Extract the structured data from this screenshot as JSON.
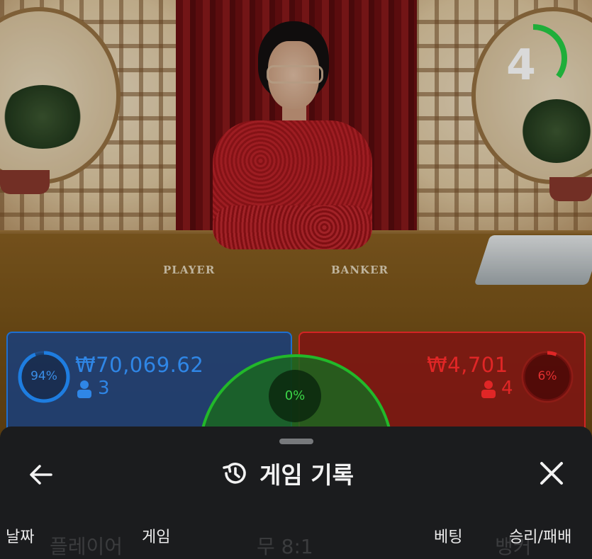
{
  "table": {
    "player_label": "PLAYER",
    "banker_label": "BANKER"
  },
  "timer": {
    "seconds": "4",
    "progress": 0.35,
    "color": "#1fae3a"
  },
  "bets": {
    "player": {
      "percent": "94%",
      "percent_value": 0.94,
      "amount": "₩70,069.62",
      "players": "3",
      "color": "#1e7de0"
    },
    "tie": {
      "percent": "0%",
      "color": "#3cd648"
    },
    "banker": {
      "percent": "6%",
      "percent_value": 0.06,
      "amount": "₩4,701",
      "players": "4",
      "color": "#e02626"
    }
  },
  "sheet": {
    "title": "게임 기록",
    "icons": {
      "back": "arrow-left-icon",
      "history": "history-icon",
      "close": "close-icon"
    },
    "columns": [
      "날짜",
      "게임",
      "베팅",
      "승리/패배"
    ],
    "row_preview": [
      "플레이어",
      "무 8:1",
      "뱅커"
    ]
  }
}
